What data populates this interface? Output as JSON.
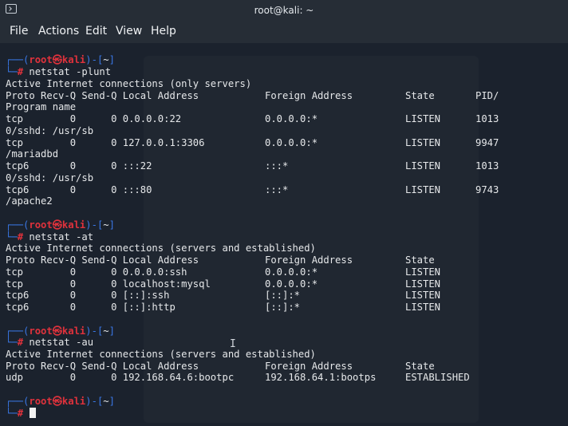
{
  "window": {
    "title": "root@kali: ~"
  },
  "menu": [
    "File",
    "Actions",
    "Edit",
    "View",
    "Help"
  ],
  "prompt": {
    "corner_top": "┌──",
    "user": "root",
    "at": "㉿",
    "host": "kali",
    "dir_open": ")-[",
    "dir": "~",
    "dir_close": "]",
    "corner_bottom": "└─",
    "hash": "#"
  },
  "blocks": [
    {
      "command": "netstat -plunt",
      "header_line": "Active Internet connections (only servers)",
      "columns": [
        "Proto Recv-Q Send-Q Local Address",
        "Foreign Address",
        "State",
        "PID/"
      ],
      "columns_cont": "Program name",
      "rows": [
        {
          "main": "tcp        0      0 0.0.0.0:22",
          "foreign": "0.0.0.0:*",
          "state": "LISTEN",
          "pid": "1013",
          "cont": "0/sshd: /usr/sb"
        },
        {
          "main": "tcp        0      0 127.0.0.1:3306",
          "foreign": "0.0.0.0:*",
          "state": "LISTEN",
          "pid": "9947",
          "cont": "/mariadbd"
        },
        {
          "main": "tcp6       0      0 :::22",
          "foreign": ":::*",
          "state": "LISTEN",
          "pid": "1013",
          "cont": "0/sshd: /usr/sb"
        },
        {
          "main": "tcp6       0      0 :::80",
          "foreign": ":::*",
          "state": "LISTEN",
          "pid": "9743",
          "cont": "/apache2"
        }
      ]
    },
    {
      "command": "netstat -at",
      "header_line": "Active Internet connections (servers and established)",
      "columns": [
        "Proto Recv-Q Send-Q Local Address",
        "Foreign Address",
        "State"
      ],
      "rows": [
        {
          "main": "tcp        0      0 0.0.0.0:ssh",
          "foreign": "0.0.0.0:*",
          "state": "LISTEN"
        },
        {
          "main": "tcp        0      0 localhost:mysql",
          "foreign": "0.0.0.0:*",
          "state": "LISTEN"
        },
        {
          "main": "tcp6       0      0 [::]:ssh",
          "foreign": "[::]:*",
          "state": "LISTEN"
        },
        {
          "main": "tcp6       0      0 [::]:http",
          "foreign": "[::]:*",
          "state": "LISTEN"
        }
      ]
    },
    {
      "command": "netstat -au",
      "header_line": "Active Internet connections (servers and established)",
      "columns": [
        "Proto Recv-Q Send-Q Local Address",
        "Foreign Address",
        "State"
      ],
      "rows": [
        {
          "main": "udp        0      0 192.168.64.6:bootpc",
          "foreign": "192.168.64.1:bootps",
          "state": "ESTABLISHED"
        }
      ]
    }
  ],
  "colors": {
    "prompt_frame": "#3a78e6",
    "prompt_user": "#e0323c",
    "text": "#e6e8ea",
    "background": "#1b222d",
    "chrome": "#262d36"
  }
}
